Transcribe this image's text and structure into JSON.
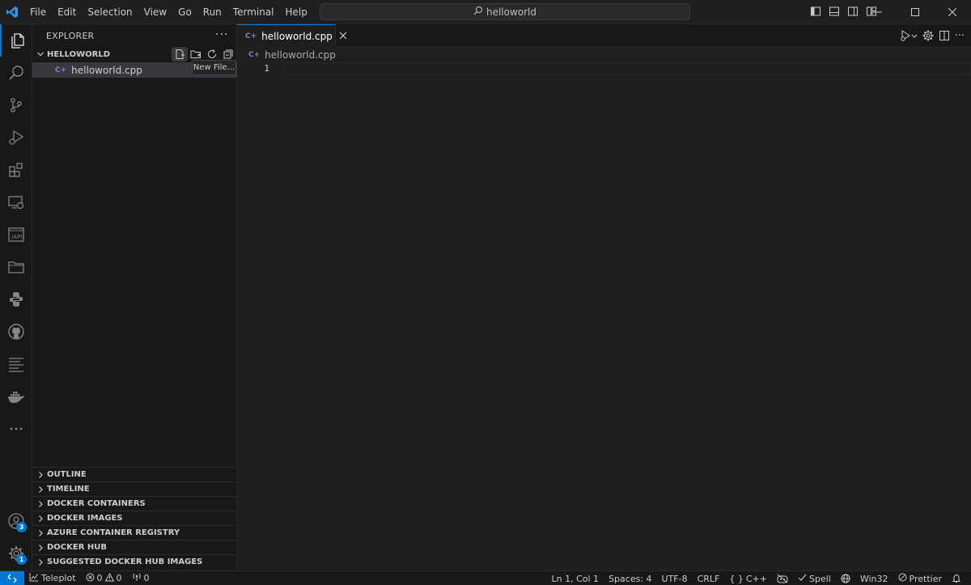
{
  "menu": [
    "File",
    "Edit",
    "Selection",
    "View",
    "Go",
    "Run",
    "Terminal",
    "Help"
  ],
  "search": {
    "text": "helloworld"
  },
  "sidebar": {
    "title": "EXPLORER",
    "folder": "HELLOWORLD",
    "files": [
      {
        "name": "helloworld.cpp",
        "icon_text": "C+"
      }
    ],
    "tooltip": "New File...",
    "sections": [
      "OUTLINE",
      "TIMELINE",
      "DOCKER CONTAINERS",
      "DOCKER IMAGES",
      "AZURE CONTAINER REGISTRY",
      "DOCKER HUB",
      "SUGGESTED DOCKER HUB IMAGES"
    ]
  },
  "activity": {
    "accounts_badge": "3",
    "settings_badge": "1"
  },
  "editor": {
    "tab_label": "helloworld.cpp",
    "breadcrumb": "helloworld.cpp",
    "line_numbers": [
      "1"
    ]
  },
  "status": {
    "teleplot": "Teleplot",
    "errors": "0",
    "warnings": "0",
    "ports": "0",
    "position": "Ln 1, Col 1",
    "spaces": "Spaces: 4",
    "encoding": "UTF-8",
    "eol": "CRLF",
    "language": "C++",
    "spell": "Spell",
    "platform": "Win32",
    "prettier": "Prettier"
  },
  "colors": {
    "accent": "#0078d4",
    "cpp": "#a074c4"
  }
}
